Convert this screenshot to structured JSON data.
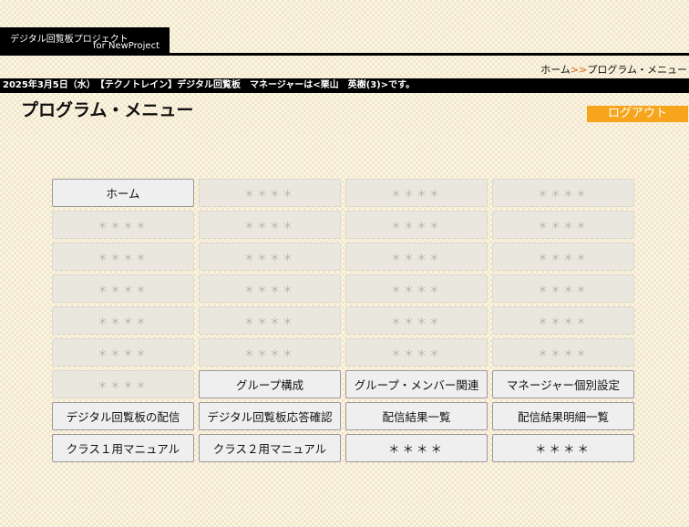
{
  "header": {
    "logo_line1": "デジタル回覧板プロジェクト",
    "logo_line2": "for NewProject"
  },
  "breadcrumb": {
    "home": "ホーム",
    "separator": ">>",
    "current": "プログラム・メニュー"
  },
  "info_bar": {
    "text": "2025年3月5日（水）　【テクノトレイン】デジタル回覧板　マネージャーは<栗山　英樹(3)>です。"
  },
  "page": {
    "title": "プログラム・メニュー",
    "logout_label": "ログアウト"
  },
  "colors": {
    "logout_bg": "#f7a51c",
    "breadcrumb_separator": "#e06010"
  },
  "menu": [
    {
      "label": "ホーム",
      "enabled": true
    },
    {
      "label": "＊＊＊＊",
      "enabled": false
    },
    {
      "label": "＊＊＊＊",
      "enabled": false
    },
    {
      "label": "＊＊＊＊",
      "enabled": false
    },
    {
      "label": "＊＊＊＊",
      "enabled": false
    },
    {
      "label": "＊＊＊＊",
      "enabled": false
    },
    {
      "label": "＊＊＊＊",
      "enabled": false
    },
    {
      "label": "＊＊＊＊",
      "enabled": false
    },
    {
      "label": "＊＊＊＊",
      "enabled": false
    },
    {
      "label": "＊＊＊＊",
      "enabled": false
    },
    {
      "label": "＊＊＊＊",
      "enabled": false
    },
    {
      "label": "＊＊＊＊",
      "enabled": false
    },
    {
      "label": "＊＊＊＊",
      "enabled": false
    },
    {
      "label": "＊＊＊＊",
      "enabled": false
    },
    {
      "label": "＊＊＊＊",
      "enabled": false
    },
    {
      "label": "＊＊＊＊",
      "enabled": false
    },
    {
      "label": "＊＊＊＊",
      "enabled": false
    },
    {
      "label": "＊＊＊＊",
      "enabled": false
    },
    {
      "label": "＊＊＊＊",
      "enabled": false
    },
    {
      "label": "＊＊＊＊",
      "enabled": false
    },
    {
      "label": "＊＊＊＊",
      "enabled": false
    },
    {
      "label": "＊＊＊＊",
      "enabled": false
    },
    {
      "label": "＊＊＊＊",
      "enabled": false
    },
    {
      "label": "＊＊＊＊",
      "enabled": false
    },
    {
      "label": "＊＊＊＊",
      "enabled": false
    },
    {
      "label": "グループ構成",
      "enabled": true
    },
    {
      "label": "グループ・メンバー関連",
      "enabled": true
    },
    {
      "label": "マネージャー個別設定",
      "enabled": true
    },
    {
      "label": "デジタル回覧板の配信",
      "enabled": true
    },
    {
      "label": "デジタル回覧板応答確認",
      "enabled": true
    },
    {
      "label": "配信結果一覧",
      "enabled": true
    },
    {
      "label": "配信結果明細一覧",
      "enabled": true
    },
    {
      "label": "クラス１用マニュアル",
      "enabled": true
    },
    {
      "label": "クラス２用マニュアル",
      "enabled": true
    },
    {
      "label": "＊＊＊＊",
      "enabled": true
    },
    {
      "label": "＊＊＊＊",
      "enabled": true
    }
  ]
}
